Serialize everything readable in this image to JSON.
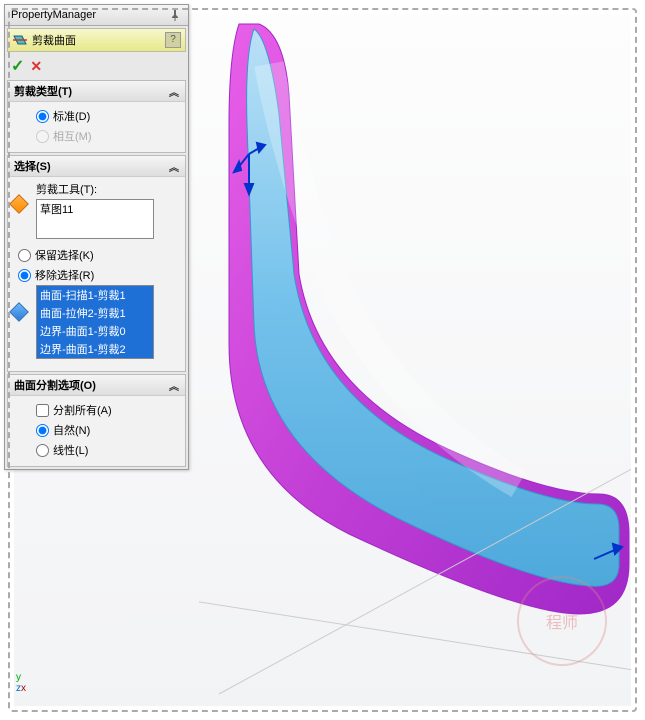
{
  "header": {
    "title": "PropertyManager"
  },
  "feature": {
    "icon": "trim-surface-icon",
    "title": "剪裁曲面"
  },
  "actions": {
    "ok": "✓",
    "cancel": "✕"
  },
  "sections": {
    "trimType": {
      "title": "剪裁类型(T)",
      "options": {
        "standard": {
          "label": "标准(D)",
          "checked": true
        },
        "mutual": {
          "label": "相互(M)",
          "checked": false,
          "disabled": true
        }
      }
    },
    "selection": {
      "title": "选择(S)",
      "toolLabel": "剪裁工具(T):",
      "toolItems": [
        "草图11"
      ],
      "keepRemove": {
        "keep": {
          "label": "保留选择(K)",
          "checked": false
        },
        "remove": {
          "label": "移除选择(R)",
          "checked": true
        }
      },
      "bodies": [
        {
          "label": "曲面-扫描1-剪裁1",
          "selected": true
        },
        {
          "label": "曲面-拉伸2-剪裁1",
          "selected": true
        },
        {
          "label": "边界-曲面1-剪裁0",
          "selected": true
        },
        {
          "label": "边界-曲面1-剪裁2",
          "selected": true
        }
      ]
    },
    "splitOptions": {
      "title": "曲面分割选项(O)",
      "splitAll": {
        "label": "分割所有(A)",
        "checked": false
      },
      "natural": {
        "label": "自然(N)",
        "checked": true
      },
      "linear": {
        "label": "线性(L)",
        "checked": false
      }
    }
  },
  "axis": {
    "y": "y",
    "x": "x",
    "z": "z"
  },
  "watermark": "程师"
}
